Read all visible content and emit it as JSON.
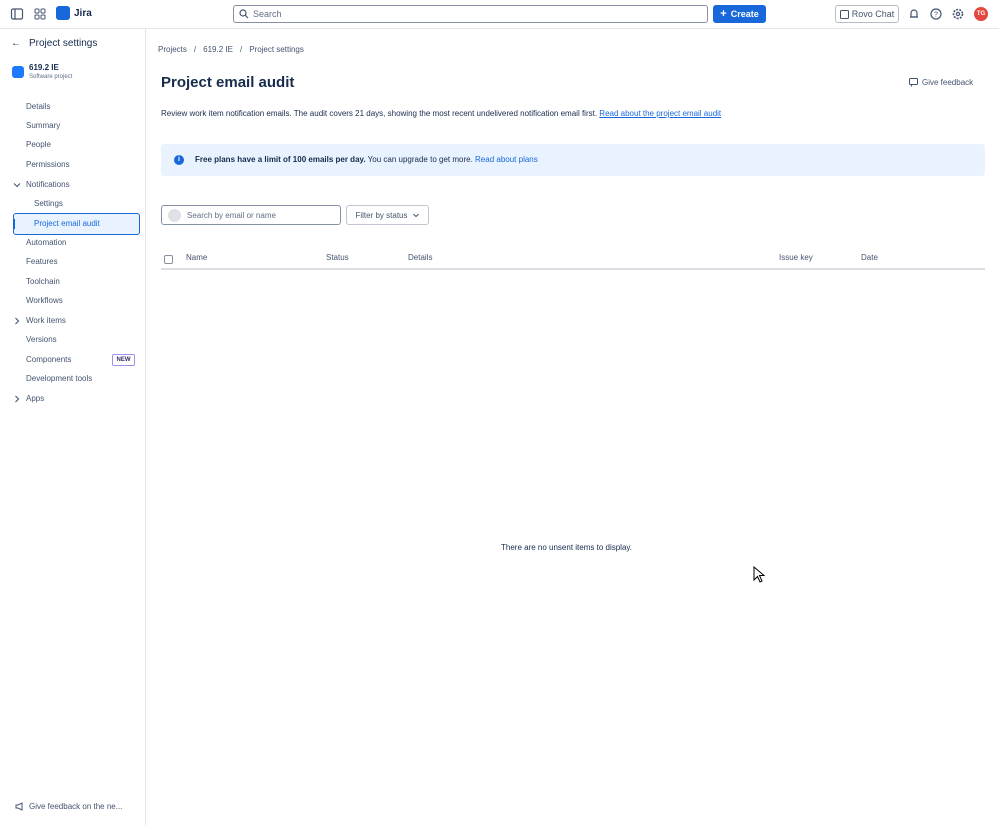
{
  "topbar": {
    "app_name": "Jira",
    "search_placeholder": "Search",
    "create_label": "Create",
    "rovo_label": "Rovo Chat",
    "avatar_initials": "TG",
    "accent": "#1868db"
  },
  "sidebar": {
    "back_label": "Project settings",
    "project_name": "619.2 IE",
    "project_type": "Software project",
    "items": [
      {
        "label": "Details"
      },
      {
        "label": "Summary"
      },
      {
        "label": "People"
      },
      {
        "label": "Permissions"
      },
      {
        "label": "Notifications"
      },
      {
        "label": "Settings"
      },
      {
        "label": "Project email audit"
      },
      {
        "label": "Automation"
      },
      {
        "label": "Features"
      },
      {
        "label": "Toolchain"
      },
      {
        "label": "Workflows"
      },
      {
        "label": "Work items"
      },
      {
        "label": "Versions"
      },
      {
        "label": "Components"
      },
      {
        "label": "Development tools"
      },
      {
        "label": "Apps"
      }
    ],
    "new_badge": "NEW",
    "feedback_label": "Give feedback on the ne..."
  },
  "main": {
    "breadcrumb": [
      "Projects",
      "/",
      "619.2 IE",
      "/",
      "Project settings"
    ],
    "title": "Project email audit",
    "give_feedback": "Give feedback",
    "description": "Review work item notification emails. The audit covers 21 days, showing the most recent undelivered notification email first.",
    "description_link": "Read about the project email audit",
    "banner_bold": "Free plans have a limit of 100 emails per day.",
    "banner_text": "You can upgrade to get more.",
    "banner_link": "Read about plans",
    "search_placeholder": "Search by email or name",
    "filter_label": "Filter by status",
    "columns": [
      "Name",
      "Status",
      "Details",
      "Issue key",
      "Date"
    ],
    "empty_message": "There are no unsent items to display."
  }
}
